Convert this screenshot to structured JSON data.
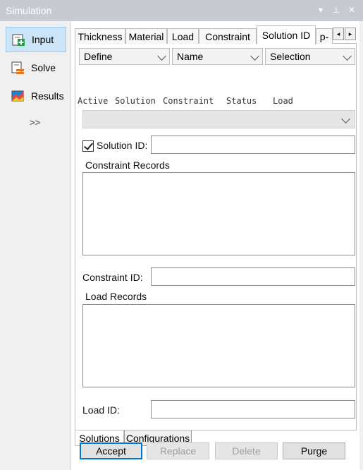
{
  "window": {
    "title": "Simulation",
    "controls": [
      "▾",
      "⊥",
      "✕"
    ]
  },
  "sidebar": {
    "items": [
      {
        "label": "Input",
        "icon": "input-icon"
      },
      {
        "label": "Solve",
        "icon": "solve-icon"
      },
      {
        "label": "Results",
        "icon": "results-icon"
      }
    ],
    "more_label": ">>"
  },
  "tabs": {
    "items": [
      "Thickness",
      "Material",
      "Load",
      "Constraint",
      "Solution ID",
      "p-"
    ],
    "active": "Solution ID",
    "scroll_left": "◂",
    "scroll_right": "▸"
  },
  "filters": {
    "define": "Define",
    "name": "Name",
    "selection": "Selection"
  },
  "table_header": {
    "columns": [
      "Active",
      "Solution",
      "Constraint",
      "Status",
      "Load"
    ]
  },
  "form": {
    "solution_id_label": "Solution ID:",
    "solution_id_value": "",
    "solution_id_checked": true,
    "constraint_records_label": "Constraint Records",
    "constraint_id_label": "Constraint ID:",
    "constraint_id_value": "",
    "load_records_label": "Load Records",
    "load_id_label": "Load ID:",
    "load_id_value": ""
  },
  "bottom_tabs": {
    "solutions": "Solutions",
    "configurations": "Configurations"
  },
  "buttons": {
    "accept": "Accept",
    "replace": "Replace",
    "delete": "Delete",
    "purge": "Purge"
  }
}
